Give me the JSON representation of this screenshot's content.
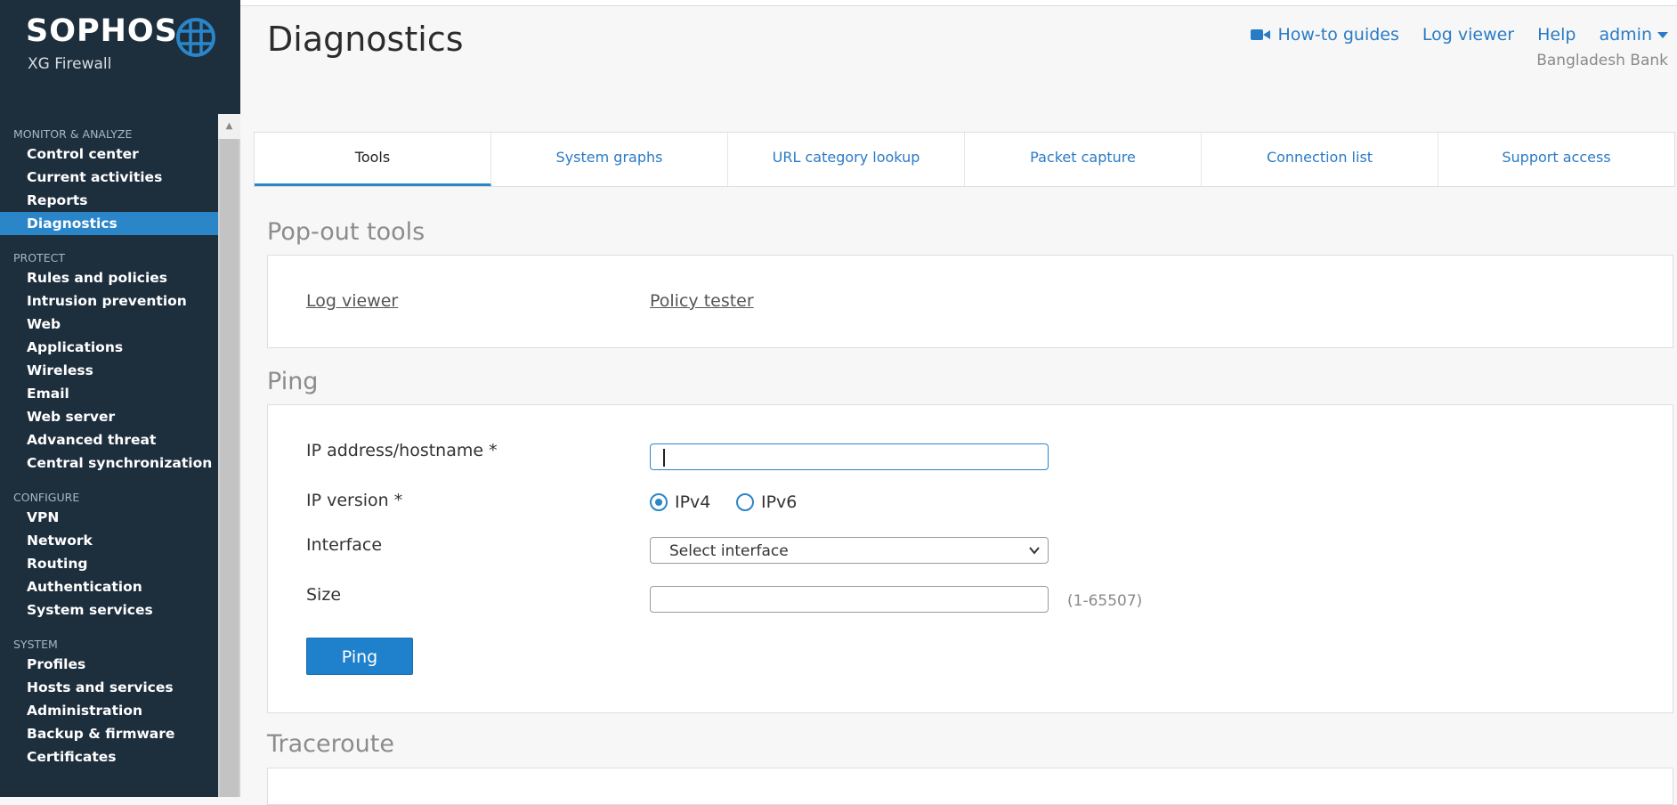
{
  "brand": {
    "name": "SOPHOS",
    "product": "XG Firewall"
  },
  "sidebar": {
    "sections": [
      {
        "header": "MONITOR & ANALYZE",
        "items": [
          "Control center",
          "Current activities",
          "Reports",
          "Diagnostics"
        ]
      },
      {
        "header": "PROTECT",
        "items": [
          "Rules and policies",
          "Intrusion prevention",
          "Web",
          "Applications",
          "Wireless",
          "Email",
          "Web server",
          "Advanced threat",
          "Central synchronization"
        ]
      },
      {
        "header": "CONFIGURE",
        "items": [
          "VPN",
          "Network",
          "Routing",
          "Authentication",
          "System services"
        ]
      },
      {
        "header": "SYSTEM",
        "items": [
          "Profiles",
          "Hosts and services",
          "Administration",
          "Backup & firmware",
          "Certificates"
        ]
      }
    ],
    "active_item": "Diagnostics"
  },
  "header": {
    "title": "Diagnostics",
    "links": {
      "howto": "How-to guides",
      "log_viewer": "Log viewer",
      "help": "Help",
      "user": "admin"
    },
    "org": "Bangladesh Bank"
  },
  "tabs": {
    "items": [
      "Tools",
      "System graphs",
      "URL category lookup",
      "Packet capture",
      "Connection list",
      "Support access"
    ],
    "active": "Tools"
  },
  "popout": {
    "title": "Pop-out tools",
    "links": [
      "Log viewer",
      "Policy tester"
    ]
  },
  "ping": {
    "title": "Ping",
    "ip_label": "IP address/hostname *",
    "ip_value": "",
    "version_label": "IP version *",
    "version_options": [
      "IPv4",
      "IPv6"
    ],
    "version_selected": "IPv4",
    "interface_label": "Interface",
    "interface_value": "Select interface",
    "size_label": "Size",
    "size_value": "",
    "size_hint": "(1-65507)",
    "button": "Ping"
  },
  "traceroute": {
    "title": "Traceroute"
  },
  "colors": {
    "sidebar_bg": "#1d2e3d",
    "accent": "#2a86c9",
    "link": "#2a7bc6"
  },
  "icons": {
    "logo": "sophos-globe-icon",
    "video": "video-camera-icon",
    "caret": "caret-down-icon",
    "chevron": "chevron-down-icon"
  }
}
